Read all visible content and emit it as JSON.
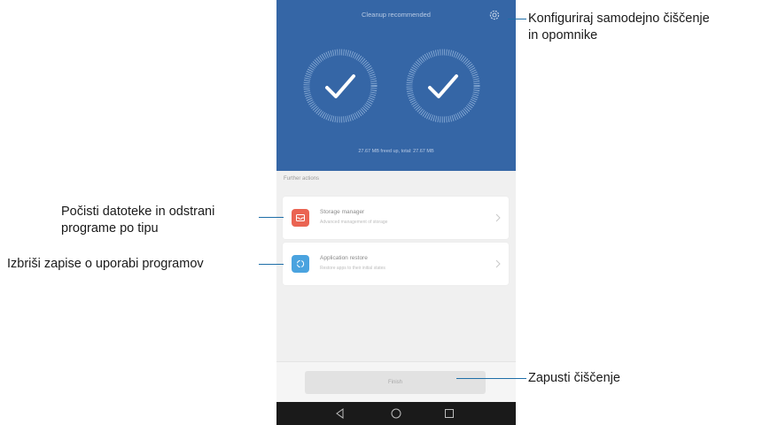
{
  "screen": {
    "header_title": "Cleanup recommended",
    "freed_text": "27.67 MB freed up, total: 27.67 MB",
    "section_label": "Further actions",
    "items": [
      {
        "title": "Storage manager",
        "subtitle": "Advanced management of storage",
        "icon": "storage-manager-icon",
        "color": "#ea6452"
      },
      {
        "title": "Application restore",
        "subtitle": "Restore apps to their initial states",
        "icon": "application-restore-icon",
        "color": "#4aa3df"
      }
    ],
    "finish_label": "Finish",
    "hero_color": "#3566a6"
  },
  "callouts": {
    "settings": [
      "Konfiguriraj samodejno čiščenje",
      "in opomnike"
    ],
    "storage": [
      "Počisti datoteke in odstrani",
      "programe po tipu"
    ],
    "restore": "Izbriši zapise o uporabi programov",
    "finish": "Zapusti čiščenje"
  }
}
